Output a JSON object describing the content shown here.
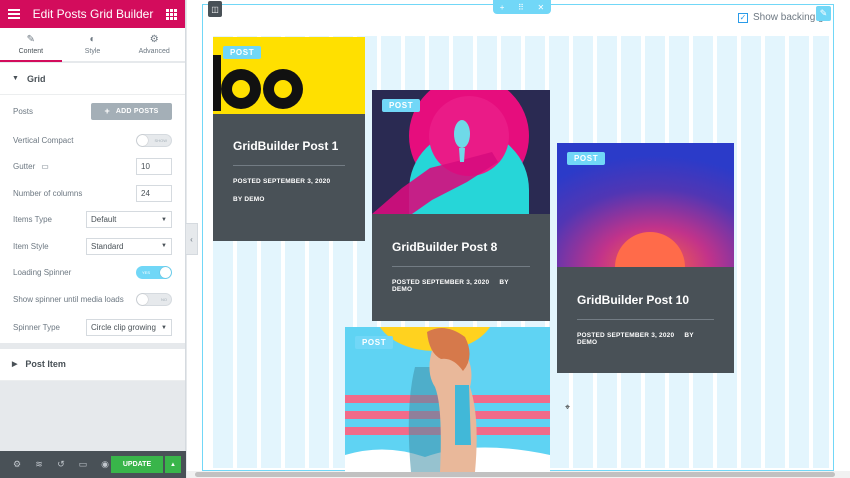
{
  "panel": {
    "title": "Edit Posts Grid Builder",
    "tabs": [
      {
        "label": "Content",
        "icon": "pencil-icon"
      },
      {
        "label": "Style",
        "icon": "contrast-icon"
      },
      {
        "label": "Advanced",
        "icon": "gear-icon"
      }
    ],
    "grid_section": {
      "title": "Grid",
      "posts_label": "Posts",
      "add_posts_label": "ADD POSTS",
      "vertical_compact_label": "Vertical Compact",
      "vertical_compact_toggle": "SHOW",
      "gutter_label": "Gutter",
      "gutter_value": "10",
      "columns_label": "Number of columns",
      "columns_value": "24",
      "items_type_label": "Items Type",
      "items_type_value": "Default",
      "item_style_label": "Item Style",
      "item_style_value": "Standard",
      "loading_spinner_label": "Loading Spinner",
      "loading_spinner_toggle": "YES",
      "show_spinner_label": "Show spinner until media loads",
      "show_spinner_toggle": "NO",
      "spinner_type_label": "Spinner Type",
      "spinner_type_value": "Circle clip growing"
    },
    "post_item_section": {
      "title": "Post Item"
    },
    "footer": {
      "update_label": "UPDATE"
    }
  },
  "preview": {
    "section_handle_label": "⠿⠿",
    "show_backing_label": "Show backing g",
    "posts": [
      {
        "badge": "POST",
        "title": "GridBuilder Post 1",
        "posted": "POSTED",
        "date": "SEPTEMBER 3, 2020",
        "by": "BY",
        "author": "DEMO"
      },
      {
        "badge": "POST",
        "title": "GridBuilder Post 8",
        "posted": "POSTED",
        "date": "SEPTEMBER 3, 2020",
        "by": "BY",
        "author": "DEMO"
      },
      {
        "badge": "POST",
        "title": "GridBuilder Post 10",
        "posted": "POSTED",
        "date": "SEPTEMBER 3, 2020",
        "by": "BY",
        "author": "DEMO"
      },
      {
        "badge": "POST"
      }
    ]
  },
  "colors": {
    "brand": "#d30c5c",
    "accent": "#71d7f7",
    "update_green": "#39b54a",
    "card_body": "#495157"
  }
}
